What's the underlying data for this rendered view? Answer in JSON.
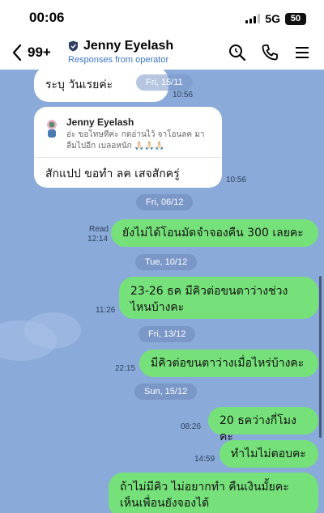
{
  "status": {
    "time": "00:06",
    "network": "5G",
    "battery": "50"
  },
  "header": {
    "back_count": "99+",
    "title": "Jenny Eyelash",
    "subtitle": "Responses from operator"
  },
  "messages": {
    "m1": {
      "text": "ระบุ วันเรยค่ะ",
      "date": "Fri, 15/11",
      "time": "10:56"
    },
    "m2": {
      "reply_name": "Jenny Eyelash",
      "reply_text": "อ่ะ ขอโทษทีค่ะ กดอ่านไว้ จาโอนลค มา ลืมไปอีก เบลอหนัก 🙏🏻🙏🏻🙏🏻",
      "text": "สักแปป ขอทำ ลค เสจสักครู่",
      "time": "10:56"
    },
    "date1": "Fri, 06/12",
    "m3": {
      "read": "Read",
      "time": "12:14",
      "text": "ยังไม่ได้โอนมัดจำจองคืน 300 เลยคะ"
    },
    "date2": "Tue, 10/12",
    "m4": {
      "time": "11:26",
      "text": "23-26 ธค มีคิวต่อขนตาว่างช่วงไหนบ้างคะ"
    },
    "date3": "Fri, 13/12",
    "m5": {
      "time": "22:15",
      "text": "มีคิวต่อขนตาว่างเมื่อไหร่บ้างคะ"
    },
    "date4": "Sun, 15/12",
    "m6": {
      "time": "08:26",
      "text": "20 ธคว่างกี่โมงคะ"
    },
    "m7": {
      "time": "14:59",
      "text": "ทำไมไม่ตอบคะ"
    },
    "m8": {
      "text": "ถ้าไม่มีคิว ไม่อยากทำ คืนเงินมั้ยคะ เห็นเพื่อนยังจองได้"
    }
  },
  "icons": {
    "back": "chevron-left-icon",
    "shield": "shield-icon",
    "search": "search-icon",
    "call": "phone-icon",
    "menu": "menu-icon"
  },
  "colors": {
    "chat_bg": "#8aaad9",
    "outgoing_bubble": "#76e07a",
    "incoming_bubble": "#ffffff",
    "date_pill": "#7a97c8",
    "subtitle": "#3b76c8"
  }
}
